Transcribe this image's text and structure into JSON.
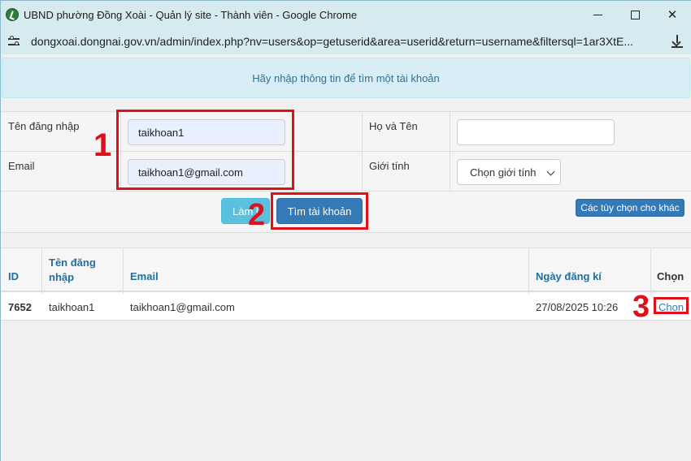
{
  "window": {
    "title": "UBND phường Đồng Xoài - Quản lý site - Thành viên - Google Chrome",
    "url": "dongxoai.dongnai.gov.vn/admin/index.php?nv=users&op=getuserid&area=userid&return=username&filtersql=1ar3XtE..."
  },
  "page": {
    "info_message": "Hãy nhập thông tin để tìm một tài khoản",
    "form": {
      "username_label": "Tên đăng nhập",
      "username_value": "taikhoan1",
      "fullname_label": "Họ và Tên",
      "fullname_value": "",
      "email_label": "Email",
      "email_value": "taikhoan1@gmail.com",
      "gender_label": "Giới tính",
      "gender_selected": "Chọn giới tính",
      "reset_button": "Làm l",
      "find_button": "Tìm tài khoản",
      "more_options_button": "Các tùy chọn cho khác"
    },
    "table": {
      "headers": [
        "ID",
        "Tên đăng nhập",
        "Email",
        "Ngày đăng kí",
        "Chọn"
      ],
      "username_header_line1": "Tên đăng",
      "username_header_line2": "nhập",
      "rows": [
        {
          "id": "7652",
          "username": "taikhoan1",
          "email": "taikhoan1@gmail.com",
          "registered": "27/08/2025 10:26",
          "action": "Chọn"
        }
      ]
    }
  },
  "annotations": {
    "step1": "1",
    "step2": "2",
    "step3": "3",
    "color": "#e0101a"
  },
  "colors": {
    "primary": "#337ab7",
    "info": "#5bc0de",
    "alert_bg": "#d9edf7",
    "chrome_bg": "#d6ebf0"
  }
}
